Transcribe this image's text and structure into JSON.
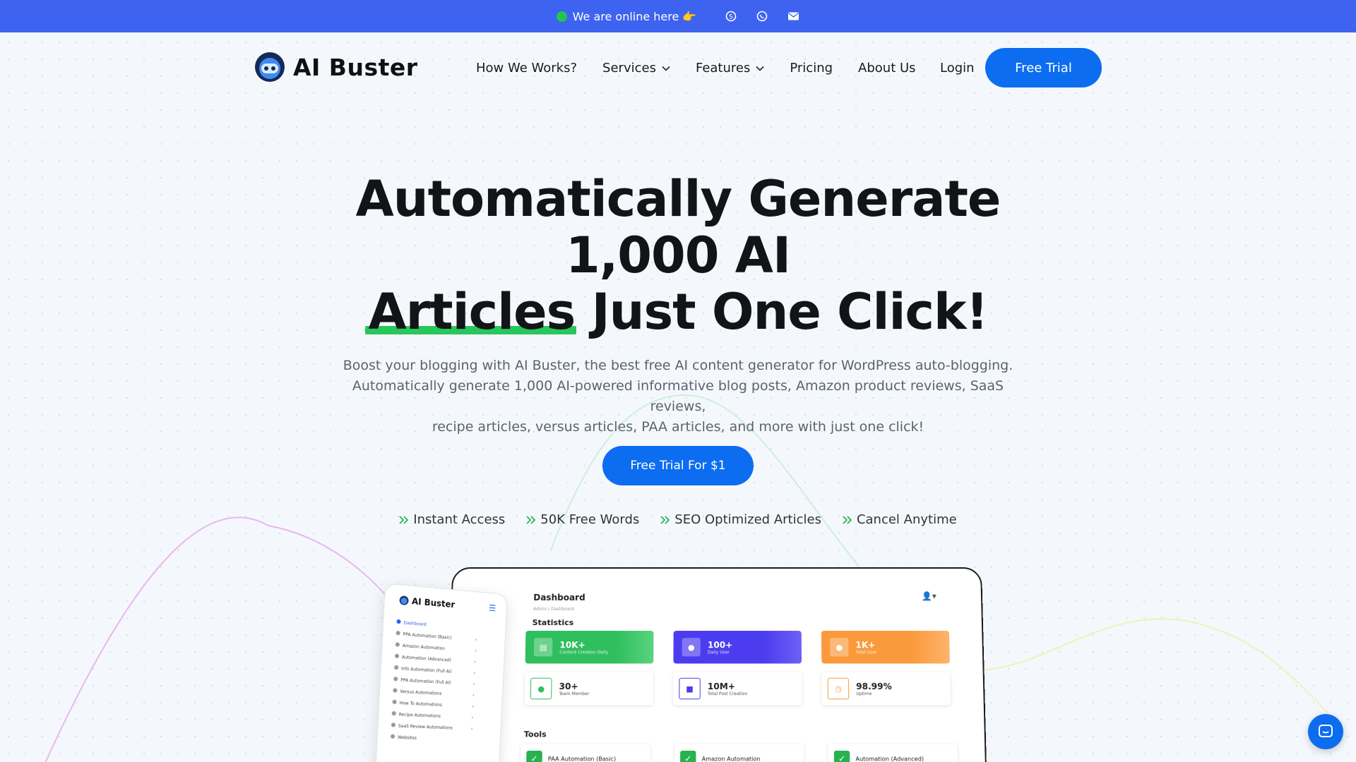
{
  "topbar": {
    "online_text": "We are online here 👉",
    "icons": [
      "skype-icon",
      "whatsapp-icon",
      "mail-icon"
    ]
  },
  "header": {
    "logo_text": "AI Buster",
    "nav": [
      {
        "label": "How We Works?",
        "has_dropdown": false
      },
      {
        "label": "Services",
        "has_dropdown": true
      },
      {
        "label": "Features",
        "has_dropdown": true
      },
      {
        "label": "Pricing",
        "has_dropdown": false
      },
      {
        "label": "About Us",
        "has_dropdown": false
      }
    ],
    "login_label": "Login",
    "trial_label": "Free Trial"
  },
  "hero": {
    "title_line1": "Automatically Generate",
    "title_line2": "1,000 AI",
    "title_highlight": "Articles",
    "title_line3_rest": " Just One Click!",
    "subtitle_line1": "Boost your blogging with AI Buster, the best free AI content generator for WordPress auto-blogging.",
    "subtitle_line2": "Automatically generate 1,000 AI-powered informative blog posts, Amazon product reviews, SaaS reviews,",
    "subtitle_line3": "recipe articles, versus articles, PAA articles, and more with just one click!",
    "cta_label": "Free Trial For $1",
    "features": [
      "Instant Access",
      "50K Free Words",
      "SEO Optimized Articles",
      "Cancel Anytime"
    ]
  },
  "dashboard": {
    "title": "Dashboard",
    "breadcrumb": "Admin / Dashboard",
    "statistics_label": "Statistics",
    "stats_top": [
      {
        "value": "10K+",
        "label": "Content Creation Daily",
        "color": "#2fbf5e"
      },
      {
        "value": "100+",
        "label": "Daily User",
        "color": "#4b3cf0"
      },
      {
        "value": "1K+",
        "label": "Total User",
        "color": "#fb9a3c"
      }
    ],
    "stats_bottom": [
      {
        "value": "30+",
        "label": "Team Member"
      },
      {
        "value": "10M+",
        "label": "Total Post Creation"
      },
      {
        "value": "98.99%",
        "label": "Uptime"
      }
    ],
    "tools_label": "Tools",
    "tools": [
      "PAA Automation (Basic)",
      "Amazon Automation",
      "Automation (Advanced)"
    ]
  },
  "sidebar": {
    "logo_text": "AI Buster",
    "items": [
      {
        "label": "Dashboard",
        "active": true
      },
      {
        "label": "PPA Automation (Basic)",
        "active": false
      },
      {
        "label": "Amazon Automation",
        "active": false
      },
      {
        "label": "Automation (Advanced)",
        "active": false
      },
      {
        "label": "Info Automation (Full AI)",
        "active": false
      },
      {
        "label": "PPA Automation (Full AI)",
        "active": false
      },
      {
        "label": "Versus Automations",
        "active": false
      },
      {
        "label": "How To Automations",
        "active": false
      },
      {
        "label": "Recipe Automations",
        "active": false
      },
      {
        "label": "SaaS Review Automations",
        "active": false
      },
      {
        "label": "Websites",
        "active": false
      }
    ]
  },
  "colors": {
    "topbar": "#3d63f0",
    "primary_button": "#0c6df0",
    "highlight": "#27c75c"
  }
}
